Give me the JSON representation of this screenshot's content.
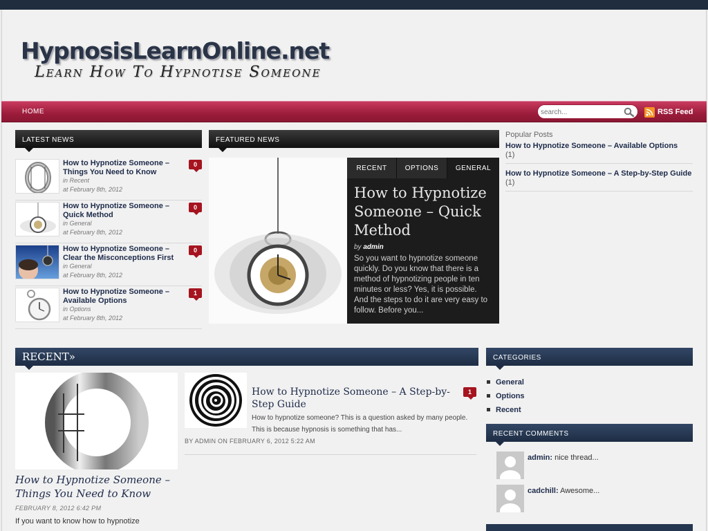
{
  "site": {
    "title": "HypnosisLearnOnline.net",
    "tagline": "Learn How To Hypnotise Someone"
  },
  "nav": {
    "home": "HOME",
    "search_placeholder": "search...",
    "rss_label": "RSS Feed"
  },
  "latest_news": {
    "heading": "LATEST NEWS",
    "items": [
      {
        "title": "How to Hypnotize Someone – Things You Need to Know",
        "category": "in Recent",
        "date": "at February 8th, 2012",
        "comments": "0",
        "thumb": "ring"
      },
      {
        "title": "How to Hypnotize Someone – Quick Method",
        "category": "in General",
        "date": "at February 8th, 2012",
        "comments": "0",
        "thumb": "pocket-watch"
      },
      {
        "title": "How to Hypnotize Someone – Clear the Misconceptions First",
        "category": "in General",
        "date": "at February 8th, 2012",
        "comments": "0",
        "thumb": "woman-watch"
      },
      {
        "title": "How to Hypnotize Someone – Available Options",
        "category": "in Options",
        "date": "at February 8th, 2012",
        "comments": "1",
        "thumb": "stopwatch"
      }
    ]
  },
  "featured": {
    "heading": "FEATURED NEWS",
    "tabs": [
      "RECENT",
      "OPTIONS",
      "GENERAL"
    ],
    "active_tab": "GENERAL",
    "title": "How to Hypnotize Someone – Quick Method",
    "by_prefix": "by",
    "author": "admin",
    "excerpt": "So you want to hypnotize someone quickly. Do you know that there is a method of hypnotizing people in ten minutes or less? Yes, it is possible. And the steps to do it are very easy to follow. Before you..."
  },
  "popular": {
    "heading": "Popular Posts",
    "items": [
      {
        "title": "How to Hypnotize Someone – Available Options",
        "count": "(1)"
      },
      {
        "title": "How to Hypnotize Someone – A Step-by-Step Guide",
        "count": "(1)"
      }
    ]
  },
  "recent": {
    "heading": "RECENT»",
    "main_post": {
      "title": "How to Hypnotize Someone – Things You Need to Know",
      "date": "FEBRUARY 8, 2012 6:42 PM",
      "excerpt": "If you want to know how to hypnotize"
    },
    "side_post": {
      "title": "How to Hypnotize Someone – A Step-by-Step Guide",
      "excerpt": "How to hypnotize someone? This is a question asked by many people. This is because hypnosis is something that has...",
      "meta": "BY ADMIN ON FEBRUARY 6, 2012 5:22 AM",
      "comments": "1"
    }
  },
  "categories": {
    "heading": "CATEGORIES",
    "items": [
      "General",
      "Options",
      "Recent"
    ]
  },
  "recent_comments": {
    "heading": "RECENT COMMENTS",
    "items": [
      {
        "author": "admin:",
        "text": "nice thread..."
      },
      {
        "author": "cadchill:",
        "text": "Awesome..."
      }
    ]
  },
  "colors": {
    "nav_red": "#9c1c3b",
    "navy": "#1e2d44",
    "link": "#1e2b4a",
    "badge": "#a5141f"
  }
}
